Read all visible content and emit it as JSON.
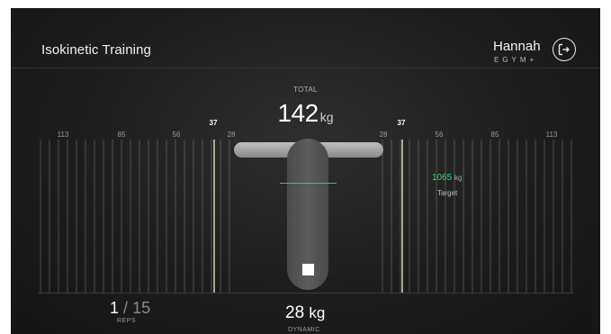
{
  "header": {
    "title": "Isokinetic Training",
    "user_name": "Hannah",
    "brand": "EGYM+",
    "logout_icon": "logout-icon"
  },
  "total": {
    "label": "TOTAL",
    "value": "142",
    "unit": "kg"
  },
  "scale": {
    "tick_labels": [
      "113",
      "85",
      "56",
      "28",
      "28",
      "56",
      "85",
      "113"
    ],
    "markers": [
      "37",
      "37"
    ]
  },
  "target": {
    "value": "1065",
    "unit": "kg",
    "label": "Target"
  },
  "reps": {
    "current": "1",
    "separator": "/",
    "total": "15",
    "label": "REPS"
  },
  "weight": {
    "value": "28",
    "unit": "kg",
    "label": "DYNAMIC"
  },
  "colors": {
    "target_green": "#3bd56d",
    "background": "#1d1d1d"
  },
  "controls": {
    "stop_icon": "stop-icon"
  }
}
